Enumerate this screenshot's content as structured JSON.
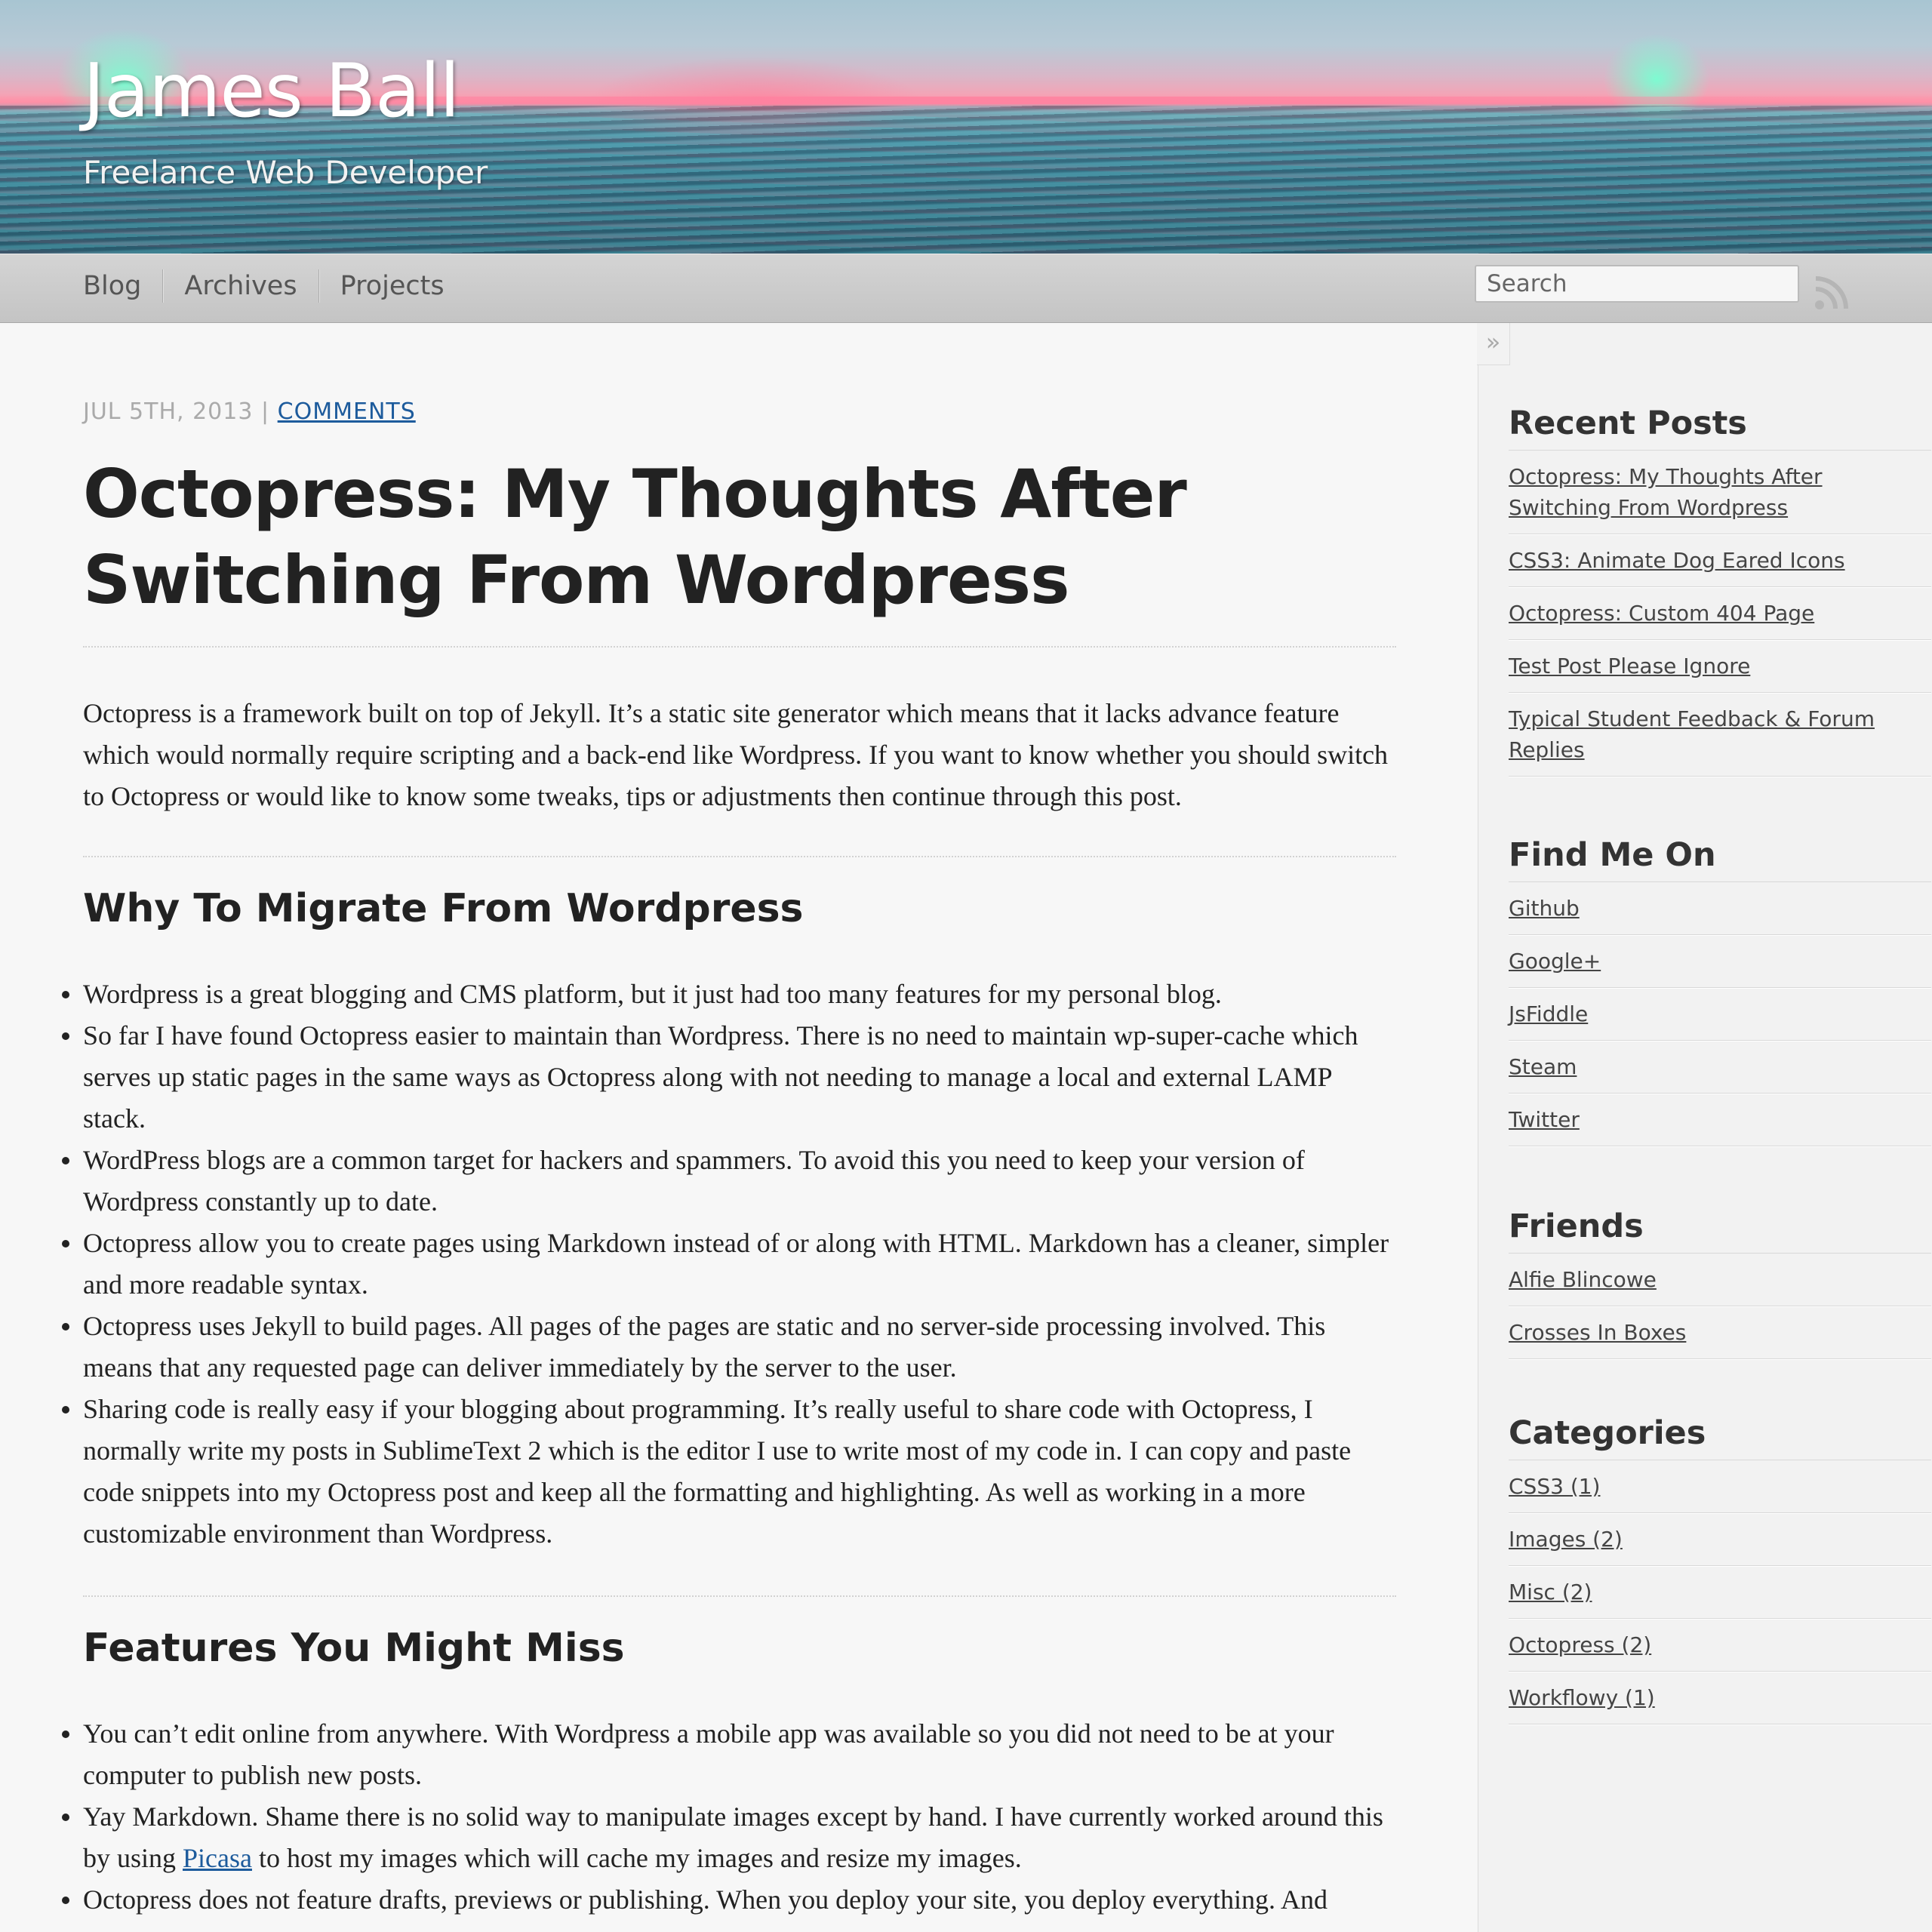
{
  "header": {
    "title": "James Ball",
    "subtitle": "Freelance Web Developer"
  },
  "nav": {
    "items": [
      "Blog",
      "Archives",
      "Projects"
    ],
    "search_placeholder": "Search",
    "rss_icon": "rss-icon"
  },
  "post": {
    "date": "JUL 5TH, 2013",
    "separator": "|",
    "comments_link": "COMMENTS",
    "title": "Octopress: My Thoughts After Switching From Wordpress",
    "intro": "Octopress is a framework built on top of Jekyll. It’s a static site generator which means that it lacks advance feature which would normally require scripting and a back-end like Wordpress. If you want to know whether you should switch to Octopress or would like to know some tweaks, tips or adjustments then continue through this post.",
    "sections": [
      {
        "heading": "Why To Migrate From Wordpress",
        "bullets": [
          "Wordpress is a great blogging and CMS platform, but it just had too many features for my personal blog.",
          "So far I have found Octopress easier to maintain than Wordpress. There is no need to maintain wp-super-cache which serves up static pages in the same ways as Octopress along with not needing to manage a local and external LAMP stack.",
          "WordPress blogs are a common target for hackers and spammers. To avoid this you need to keep your version of Wordpress constantly up to date.",
          "Octopress allow you to create pages using Markdown instead of or along with HTML. Markdown has a cleaner, simpler and more readable syntax.",
          "Octopress uses Jekyll to build pages. All pages of the pages are static and no server-side processing involved. This means that any requested page can deliver immediately by the server to the user.",
          "Sharing code is really easy if your blogging about programming. It’s really useful to share code with Octopress, I normally write my posts in SublimeText 2 which is the editor I use to write most of my code in. I can copy and paste code snippets into my Octopress post and keep all the formatting and highlighting. As well as working in a more customizable environment than Wordpress."
        ]
      },
      {
        "heading": "Features You Might Miss",
        "bullets": [
          "You can’t edit online from anywhere. With Wordpress a mobile app was available so you did not need to be at your computer to publish new posts.",
          "Octopress does not feature drafts, previews or publishing. When you deploy your site, you deploy everything. And"
        ],
        "picasa_bullet": {
          "before": "Yay Markdown. Shame there is no solid way to manipulate images except by hand. I have currently worked around this by using ",
          "link": "Picasa",
          "after": " to host my images which will cache my images and resize my images."
        }
      }
    ]
  },
  "sidebar": {
    "toggle": "»",
    "recent_posts": {
      "title": "Recent Posts",
      "items": [
        "Octopress: My Thoughts After Switching From Wordpress",
        "CSS3: Animate Dog Eared Icons",
        "Octopress: Custom 404 Page",
        "Test Post Please Ignore",
        "Typical Student Feedback & Forum Replies"
      ]
    },
    "find_me_on": {
      "title": "Find Me On",
      "items": [
        "Github",
        "Google+",
        "JsFiddle",
        "Steam",
        "Twitter"
      ]
    },
    "friends": {
      "title": "Friends",
      "items": [
        "Alfie Blincowe",
        "Crosses In Boxes"
      ]
    },
    "categories": {
      "title": "Categories",
      "items": [
        "CSS3 (1)",
        "Images (2)",
        "Misc (2)",
        "Octopress (2)",
        "Workflowy (1)"
      ]
    }
  }
}
